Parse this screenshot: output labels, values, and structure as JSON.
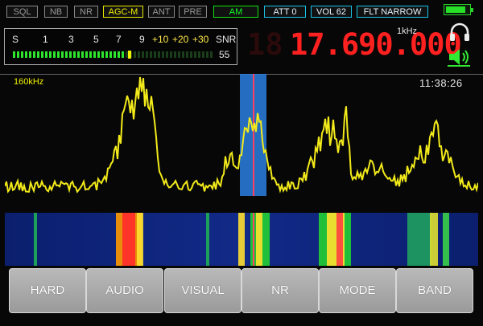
{
  "status_bar": {
    "chips": [
      {
        "label": "SQL",
        "style": "gray"
      },
      {
        "label": "NB",
        "style": "gray"
      },
      {
        "label": "NR",
        "style": "gray"
      },
      {
        "label": "AGC-M",
        "style": "yellow"
      },
      {
        "label": "ANT",
        "style": "gray"
      },
      {
        "label": "PRE",
        "style": "gray"
      },
      {
        "label": "AM",
        "style": "green"
      },
      {
        "label": "ATT 0",
        "style": "cyan"
      },
      {
        "label": "VOL 62",
        "style": "cyan"
      },
      {
        "label": "FLT NARROW",
        "style": "cyan"
      }
    ],
    "battery_level": 0.85
  },
  "smeter": {
    "scale": [
      "S",
      "1",
      "3",
      "5",
      "7",
      "9",
      "+10",
      "+20",
      "+30"
    ],
    "snr_label": "SNR",
    "snr_value": "55",
    "signal_level": 0.56,
    "peak_level": 0.57
  },
  "frequency": {
    "ghost_digits": "18",
    "display": "17.690.000",
    "step_label": "1kHz"
  },
  "icons": {
    "headphones": "headphones-icon",
    "speaker": "speaker-icon"
  },
  "spectrum": {
    "span_label": "160kHz",
    "clock": "11:38:26"
  },
  "buttons": [
    "HARD",
    "AUDIO",
    "VISUAL",
    "NR",
    "MODE",
    "BAND"
  ],
  "colors": {
    "trace": "#f2ea1a",
    "passband": "#2a7fe0",
    "center_line": "#ff4060",
    "frequency": "#ff2020",
    "meter_green": "#2ee62e"
  }
}
